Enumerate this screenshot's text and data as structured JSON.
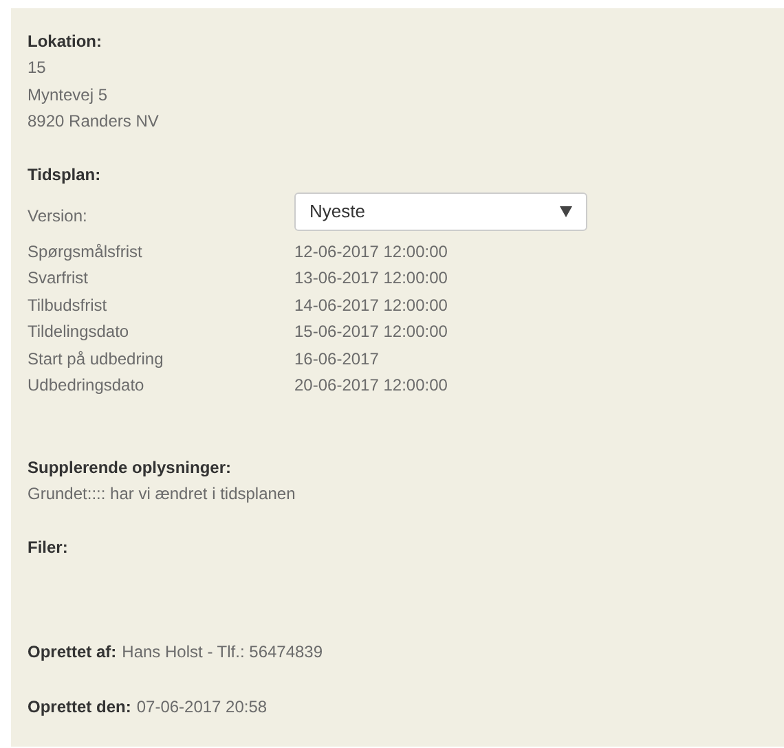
{
  "location": {
    "heading": "Lokation:",
    "lines": [
      "15",
      "Myntevej 5",
      "8920 Randers NV"
    ]
  },
  "schedule": {
    "heading": "Tidsplan:",
    "version_label": "Version:",
    "version_select": {
      "value": "Nyeste"
    },
    "rows": [
      {
        "label": "Spørgsmålsfrist",
        "value": "12-06-2017 12:00:00"
      },
      {
        "label": "Svarfrist",
        "value": "13-06-2017 12:00:00"
      },
      {
        "label": "Tilbudsfrist",
        "value": "14-06-2017 12:00:00"
      },
      {
        "label": "Tildelingsdato",
        "value": "15-06-2017 12:00:00"
      },
      {
        "label": "Start på udbedring",
        "value": "16-06-2017"
      },
      {
        "label": "Udbedringsdato",
        "value": "20-06-2017 12:00:00"
      }
    ]
  },
  "additional_info": {
    "heading": "Supplerende oplysninger:",
    "text": "Grundet:::: har vi ændret i tidsplanen"
  },
  "files": {
    "heading": "Filer:"
  },
  "created_by": {
    "label": "Oprettet af:",
    "value": "Hans Holst - Tlf.: 56474839"
  },
  "created_on": {
    "label": "Oprettet den:",
    "value": "07-06-2017 20:58"
  }
}
